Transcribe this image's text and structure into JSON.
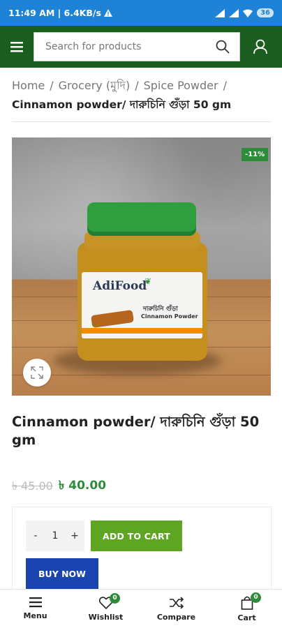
{
  "status_bar": {
    "time_speed": "11:49 AM | 6.4KB/s",
    "battery": "36"
  },
  "header": {
    "search_placeholder": "Search for products"
  },
  "breadcrumb": {
    "items": [
      "Home",
      "Grocery (মুদি)",
      "Spice Powder"
    ],
    "separator": "/",
    "current": "Cinnamon powder/ দারুচিনি গুঁড়া 50 gm"
  },
  "product": {
    "sale_badge": "-11%",
    "image_label": {
      "brand": "AdiFood",
      "name_bn": "দারুচিনি গুঁড়া",
      "name_en": "Cinnamon Powder"
    },
    "title": "Cinnamon powder/ দারুচিনি গুঁড়া 50 gm",
    "old_price": "৳ 45.00",
    "new_price": "৳ 40.00",
    "quantity": "1"
  },
  "actions": {
    "minus": "-",
    "plus": "+",
    "add_to_cart": "ADD TO CART",
    "buy_now": "BUY NOW"
  },
  "bottom_nav": {
    "menu": "Menu",
    "wishlist": "Wishlist",
    "wishlist_count": "0",
    "compare": "Compare",
    "cart": "Cart",
    "cart_count": "0"
  },
  "colors": {
    "status_bar": "#1e82d6",
    "header": "#1b5e20",
    "accent_green": "#2e8b3a",
    "add_to_cart": "#5ea522",
    "buy_now": "#1a44b0"
  }
}
